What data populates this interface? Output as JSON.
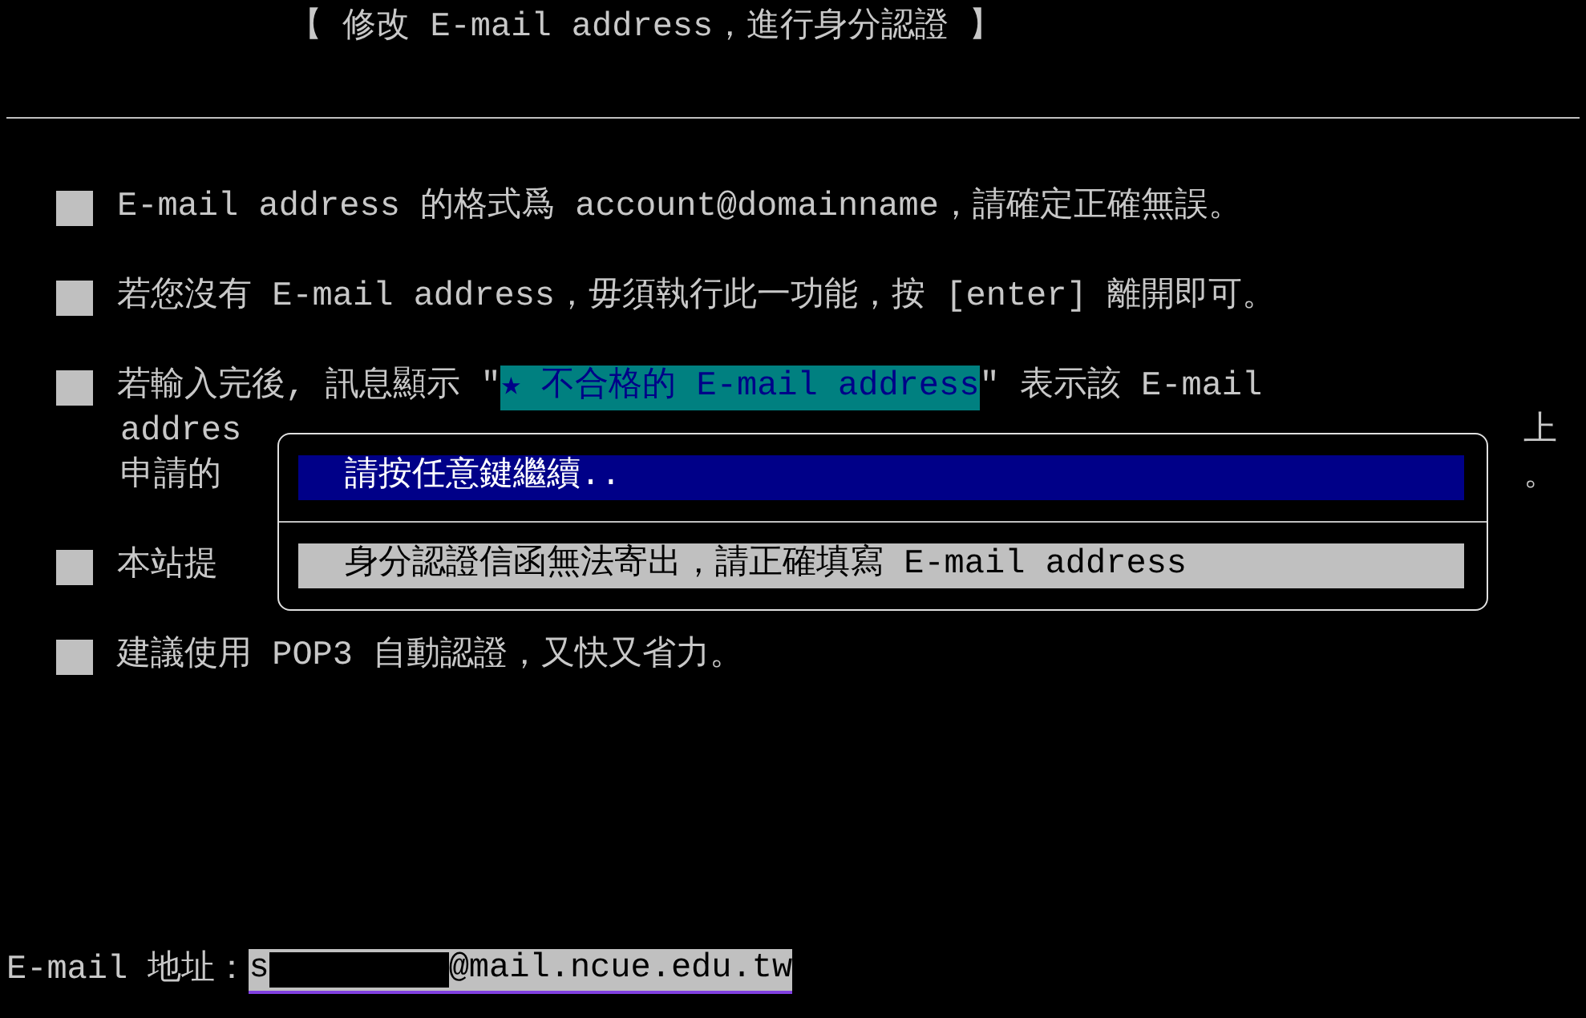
{
  "title": "【 修改 E-mail address，進行身分認證 】",
  "notes": [
    {
      "kind": "plain",
      "text": "E-mail address 的格式爲 account@domainname，請確定正確無誤。"
    },
    {
      "kind": "plain",
      "text": "若您沒有 E-mail address，毋須執行此一功能，按 [enter] 離開即可。"
    },
    {
      "kind": "message",
      "before": "若輸入完後, 訊息顯示 \"",
      "highlight": "★ 不合格的 E-mail address",
      "after": "\" 表示該 E-mail",
      "continuation": [
        {
          "left": "addres",
          "right": "上"
        },
        {
          "left": "申請的",
          "right": "。"
        }
      ]
    },
    {
      "kind": "plain",
      "text": "本站提"
    },
    {
      "kind": "plain",
      "text": "建議使用 POP3 自動認證，又快又省力。"
    }
  ],
  "dialog": {
    "prompt": "請按任意鍵繼續..",
    "message": "身分認證信函無法寄出，請正確填寫 E-mail address"
  },
  "email_field": {
    "label": "E-mail 地址：",
    "value_start": "s",
    "value_end": "@mail.ncue.edu.tw"
  }
}
